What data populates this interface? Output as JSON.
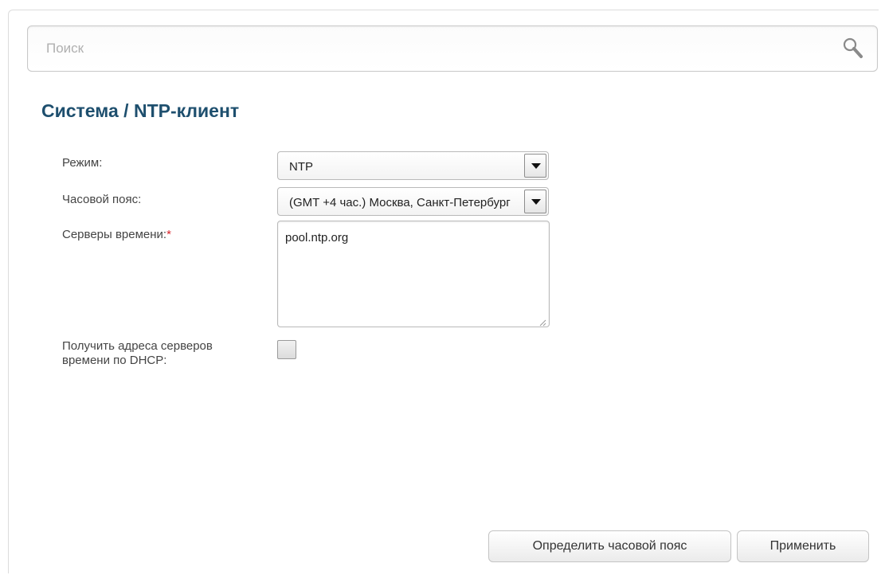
{
  "search": {
    "placeholder": "Поиск"
  },
  "page": {
    "title_section": "Система /",
    "title_page": "NTP-клиент"
  },
  "form": {
    "mode": {
      "label": "Режим:",
      "value": "NTP"
    },
    "timezone": {
      "label": "Часовой пояс:",
      "value": "(GMT +4 час.) Москва, Санкт-Петербург"
    },
    "servers": {
      "label": "Серверы времени:",
      "required_mark": "*",
      "value": "pool.ntp.org"
    },
    "dhcp": {
      "label_line1": "Получить адреса серверов",
      "label_line2": "времени по DHCP:",
      "checked": false
    }
  },
  "buttons": {
    "detect_timezone": "Определить часовой пояс",
    "apply": "Применить"
  },
  "colors": {
    "title": "#1e4f6e",
    "required": "#d8232a"
  }
}
